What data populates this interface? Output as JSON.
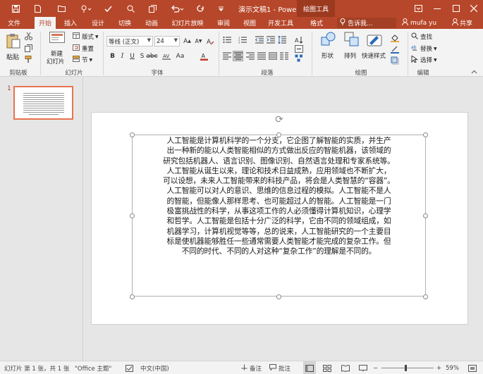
{
  "titlebar": {
    "doc_title": "演示文稿1 - Power...",
    "context_title": "绘图工具",
    "icons": [
      "save-icon",
      "undo-icon",
      "redo-icon",
      "touch-mode-icon",
      "new-icon",
      "open-icon",
      "print-preview-icon",
      "spelling-icon",
      "customize-qat-icon"
    ],
    "window_controls": [
      "ribbon-options-icon",
      "minimize-icon",
      "maximize-icon",
      "close-icon"
    ]
  },
  "tabs": [
    {
      "label": "文件",
      "active": false
    },
    {
      "label": "开始",
      "active": true
    },
    {
      "label": "插入",
      "active": false
    },
    {
      "label": "设计",
      "active": false
    },
    {
      "label": "切换",
      "active": false
    },
    {
      "label": "动画",
      "active": false
    },
    {
      "label": "幻灯片放映",
      "active": false
    },
    {
      "label": "审阅",
      "active": false
    },
    {
      "label": "视图",
      "active": false
    },
    {
      "label": "开发工具",
      "active": false
    },
    {
      "label": "格式",
      "active": false
    }
  ],
  "tell_me": "告诉我...",
  "user": "mufa yu",
  "share": "共享",
  "ribbon": {
    "clipboard": {
      "paste": "粘贴",
      "label": "剪贴板"
    },
    "slides": {
      "new_slide": "新建",
      "new_slide2": "幻灯片",
      "layout": "版式",
      "reset": "重置",
      "section": "节",
      "label": "幻灯片"
    },
    "font": {
      "name": "等线 (正文)",
      "size": "24",
      "label": "字体"
    },
    "paragraph": {
      "label": "段落"
    },
    "drawing": {
      "shapes": "形状",
      "arrange": "排列",
      "quick_styles": "快速样式",
      "label": "绘图"
    },
    "editing": {
      "find": "查找",
      "replace": "替换",
      "select": "选择",
      "label": "编辑"
    }
  },
  "thumbnail": {
    "number": "1"
  },
  "slide": {
    "lines": [
      "人工智能是计算机科学的一个分支，它企图了解智能的实质，并生产",
      "出一种新的能以人类智能相似的方式做出反应的智能机器，该领域的",
      "研究包括机器人、语言识别、图像识别、自然语言处理和专家系统等。",
      "人工智能从诞生以来，理论和技术日益成熟，应用领域也不断扩大，",
      "可以设想，未来人工智能带来的科技产品，将会是人类智慧的“容器”。",
      "人工智能可以对人的意识、思维的信息过程的模拟。人工智能不是人",
      "的智能，但能像人那样思考、也可能超过人的智能。人工智能是一门",
      "极富挑战性的科学，从事这项工作的人必须懂得计算机知识，心理学",
      "和哲学。人工智能是包括十分广泛的科学，它由不同的领域组成，如",
      "机器学习，计算机视觉等等，总的说来，人工智能研究的一个主要目",
      "标是使机器能够胜任一些通常需要人类智能才能完成的复杂工作。但",
      "不同的时代、不同的人对这种“复杂工作”的理解是不同的。"
    ]
  },
  "statusbar": {
    "slide_info": "幻灯片 第 1 张，共 1 张",
    "theme": "\"Office 主题\"",
    "language": "中文(中国)",
    "notes": "备注",
    "comments": "批注",
    "zoom": "59%",
    "colors": {
      "accent": "#b7472a"
    }
  }
}
